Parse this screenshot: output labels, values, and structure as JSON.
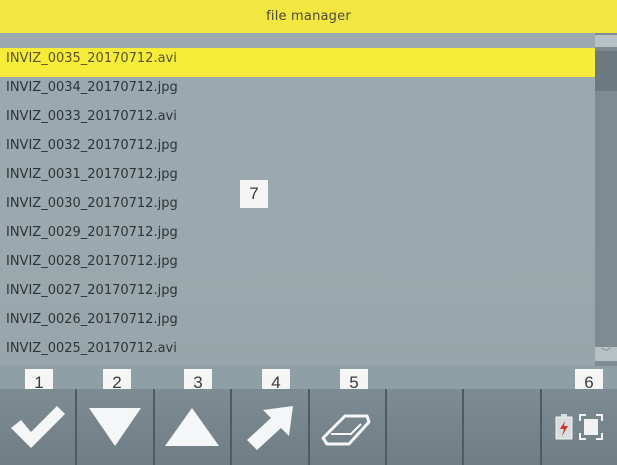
{
  "window": {
    "title": "file manager"
  },
  "files": [
    {
      "name": "INVIZ_0035_20170712.avi",
      "selected": true
    },
    {
      "name": "INVIZ_0034_20170712.jpg",
      "selected": false
    },
    {
      "name": "INVIZ_0033_20170712.avi",
      "selected": false
    },
    {
      "name": "INVIZ_0032_20170712.jpg",
      "selected": false
    },
    {
      "name": "INVIZ_0031_20170712.jpg",
      "selected": false
    },
    {
      "name": "INVIZ_0030_20170712.jpg",
      "selected": false
    },
    {
      "name": "INVIZ_0029_20170712.jpg",
      "selected": false
    },
    {
      "name": "INVIZ_0028_20170712.jpg",
      "selected": false
    },
    {
      "name": "INVIZ_0027_20170712.jpg",
      "selected": false
    },
    {
      "name": "INVIZ_0026_20170712.jpg",
      "selected": false
    },
    {
      "name": "INVIZ_0025_20170712.avi",
      "selected": false
    }
  ],
  "scrollbar": {
    "down_glyph": "﹀"
  },
  "callouts": {
    "c1": "1",
    "c2": "2",
    "c3": "3",
    "c4": "4",
    "c5": "5",
    "c6": "6",
    "c7": "7"
  },
  "toolbar": {
    "buttons": [
      {
        "name": "confirm-button",
        "icon": "checkmark-icon"
      },
      {
        "name": "move-down-button",
        "icon": "down-triangle-icon"
      },
      {
        "name": "move-up-button",
        "icon": "up-triangle-icon"
      },
      {
        "name": "open-button",
        "icon": "arrow-up-right-icon"
      },
      {
        "name": "erase-button",
        "icon": "eraser-icon"
      },
      {
        "name": "empty-button-6"
      },
      {
        "name": "empty-button-7"
      },
      {
        "name": "status-indicator",
        "icon": "battery-icon"
      }
    ]
  },
  "colors": {
    "title_bar": "#f2e640",
    "selection": "#f6ec3a",
    "list_bg": "#9aa9b0",
    "toolbar_bg": "#6d7c84"
  }
}
